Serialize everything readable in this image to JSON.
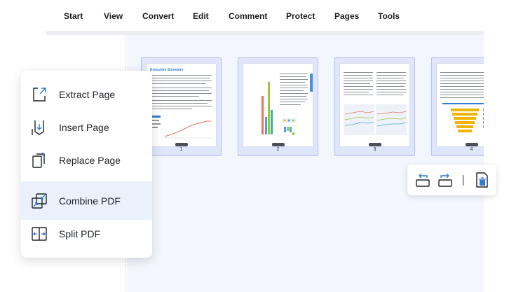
{
  "menubar": {
    "items": [
      "Start",
      "View",
      "Convert",
      "Edit",
      "Comment",
      "Protect",
      "Pages",
      "Tools"
    ]
  },
  "thumbnails": [
    {
      "page": "1",
      "heading": "Executive Summary"
    },
    {
      "page": "2"
    },
    {
      "page": "3"
    },
    {
      "page": "4"
    }
  ],
  "context_menu": {
    "items": [
      {
        "label": "Extract Page",
        "icon": "extract-page-icon"
      },
      {
        "label": "Insert Page",
        "icon": "insert-page-icon"
      },
      {
        "label": "Replace Page",
        "icon": "replace-page-icon"
      },
      {
        "label": "Combine PDF",
        "icon": "combine-pdf-icon",
        "active": true
      },
      {
        "label": "Split PDF",
        "icon": "split-pdf-icon"
      }
    ]
  },
  "page_tools": {
    "icons": [
      "rotate-left-icon",
      "rotate-right-icon",
      "delete-page-icon"
    ]
  },
  "colors": {
    "accent": "#2e7bd8",
    "thumb_selected_bg": "#dfe5fb",
    "thumb_border": "#b3c0ef",
    "menu_active_bg": "#eaf1fb",
    "workspace_bg": "#f3f6fc"
  }
}
